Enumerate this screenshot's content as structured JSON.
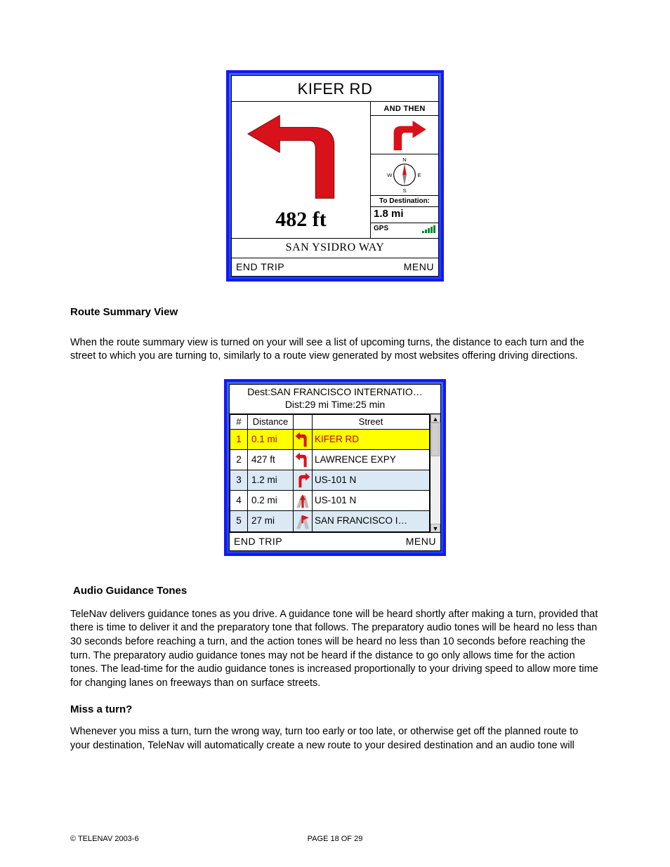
{
  "nav": {
    "title": "KIFER RD",
    "distance": "482 ft",
    "and_then_label": "AND THEN",
    "to_dest_label": "To Destination:",
    "to_dest_value": "1.8 mi",
    "gps_label": "GPS",
    "current_road": "SAN YSIDRO WAY",
    "soft_left": "END TRIP",
    "soft_right": "MENU",
    "compass": {
      "n": "N",
      "s": "S",
      "e": "E",
      "w": "W"
    }
  },
  "section1": {
    "heading": "Route Summary View",
    "body": "When the route summary view is turned on your will see a list of upcoming turns, the distance to each turn and the street to which you are turning to, similarly to a route view generated by most websites offering driving directions."
  },
  "summary": {
    "dest_line": "Dest:SAN FRANCISCO INTERNATIO…",
    "dist_line": "Dist:29 mi Time:25 min",
    "cols": {
      "num": "#",
      "dist": "Distance",
      "street": "Street"
    },
    "rows": [
      {
        "n": "1",
        "d": "0.1 mi",
        "s": "KIFER RD",
        "hl": true
      },
      {
        "n": "2",
        "d": "427 ft",
        "s": "LAWRENCE EXPY"
      },
      {
        "n": "3",
        "d": "1.2 mi",
        "s": "US-101 N",
        "alt": true
      },
      {
        "n": "4",
        "d": "0.2 mi",
        "s": "US-101 N"
      },
      {
        "n": "5",
        "d": "27 mi",
        "s": "SAN FRANCISCO I…",
        "alt": true
      }
    ],
    "soft_left": "END TRIP",
    "soft_right": "MENU"
  },
  "section2": {
    "heading": "Audio Guidance Tones",
    "body": "TeleNav delivers guidance tones as you drive. A guidance tone will be heard shortly after making a turn, provided that there is time to deliver it and the preparatory tone that follows.  The preparatory audio tones will be heard no less than 30 seconds before reaching a turn, and the action tones will be heard no less than 10 seconds before reaching the turn.   The preparatory audio guidance tones may not be heard if the distance to go only allows time for the action tones.   The lead-time for the audio guidance tones is increased proportionally to your driving speed to allow more time for changing lanes on freeways than on surface streets."
  },
  "section3": {
    "heading": "Miss a turn?",
    "body": "Whenever you miss a turn, turn the wrong way, turn too early or too late, or otherwise get off the planned route to your destination, TeleNav will automatically create a new route to your desired destination and an audio tone will"
  },
  "footer": {
    "copyright": "© TELENAV 2003-6",
    "page": "PAGE 18 OF 29"
  }
}
